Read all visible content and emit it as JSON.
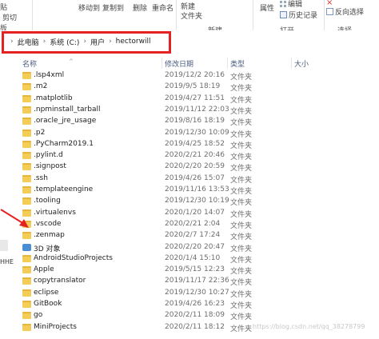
{
  "ribbon": {
    "clipboard_top": "贴",
    "cut_label": "剪切",
    "clipboard_label": "板",
    "moveto_label": "移动到",
    "copyto_label": "复制到",
    "delete_label": "删除",
    "rename_label": "重命名",
    "newfolder_label": "新建\n文件夹",
    "new_label": "新建",
    "edit_label": "编辑",
    "history_label": "历史记录",
    "properties_label": "属性",
    "open_label": "打开",
    "reverse_label": "反向选择",
    "select_label": "选择"
  },
  "address": {
    "crumbs": [
      "此电脑",
      "系统 (C:)",
      "用户",
      "hectorwill"
    ]
  },
  "columns": {
    "name": "名称",
    "date": "修改日期",
    "type": "类型",
    "size": "大小"
  },
  "left": {
    "hhe": "HHE"
  },
  "files": [
    {
      "name": ".lsp4xml",
      "date": "2019/12/2 20:16",
      "type": "文件夹",
      "icon": "folder"
    },
    {
      "name": ".m2",
      "date": "2019/9/5 18:19",
      "type": "文件夹",
      "icon": "folder"
    },
    {
      "name": ".matplotlib",
      "date": "2019/4/27 11:51",
      "type": "文件夹",
      "icon": "folder"
    },
    {
      "name": ".npminstall_tarball",
      "date": "2019/11/12 22:03",
      "type": "文件夹",
      "icon": "folder"
    },
    {
      "name": ".oracle_jre_usage",
      "date": "2019/8/16 18:19",
      "type": "文件夹",
      "icon": "folder"
    },
    {
      "name": ".p2",
      "date": "2019/12/30 10:09",
      "type": "文件夹",
      "icon": "folder"
    },
    {
      "name": ".PyCharm2019.1",
      "date": "2019/4/25 18:52",
      "type": "文件夹",
      "icon": "folder"
    },
    {
      "name": ".pylint.d",
      "date": "2020/2/21 20:46",
      "type": "文件夹",
      "icon": "folder"
    },
    {
      "name": ".signpost",
      "date": "2020/2/20 20:59",
      "type": "文件夹",
      "icon": "folder"
    },
    {
      "name": ".ssh",
      "date": "2019/4/26 15:07",
      "type": "文件夹",
      "icon": "folder"
    },
    {
      "name": ".templateengine",
      "date": "2019/11/16 13:53",
      "type": "文件夹",
      "icon": "folder"
    },
    {
      "name": ".tooling",
      "date": "2019/12/30 10:19",
      "type": "文件夹",
      "icon": "folder"
    },
    {
      "name": ".virtualenvs",
      "date": "2020/1/20 14:07",
      "type": "文件夹",
      "icon": "folder"
    },
    {
      "name": ".vscode",
      "date": "2020/2/21 2:04",
      "type": "文件夹",
      "icon": "folder"
    },
    {
      "name": ".zenmap",
      "date": "2020/2/7 17:24",
      "type": "文件夹",
      "icon": "folder"
    },
    {
      "name": "3D 对象",
      "date": "2020/2/20 20:47",
      "type": "文件夹",
      "icon": "3d"
    },
    {
      "name": "AndroidStudioProjects",
      "date": "2020/1/4 15:10",
      "type": "文件夹",
      "icon": "folder"
    },
    {
      "name": "Apple",
      "date": "2019/5/15 12:23",
      "type": "文件夹",
      "icon": "folder"
    },
    {
      "name": "copytranslator",
      "date": "2019/11/17 22:36",
      "type": "文件夹",
      "icon": "folder"
    },
    {
      "name": "eclipse",
      "date": "2019/12/30 10:27",
      "type": "文件夹",
      "icon": "folder"
    },
    {
      "name": "GitBook",
      "date": "2019/4/26 16:23",
      "type": "文件夹",
      "icon": "folder"
    },
    {
      "name": "go",
      "date": "2020/2/11 18:09",
      "type": "文件夹",
      "icon": "folder"
    },
    {
      "name": "MiniProjects",
      "date": "2020/2/11 18:12",
      "type": "文件夹",
      "icon": "folder"
    }
  ],
  "watermark": "https://blog.csdn.net/qq_38278799",
  "colors": {
    "highlight_box": "#e52222",
    "folder": "#f4cd58",
    "header_text": "#4a5d7e"
  }
}
